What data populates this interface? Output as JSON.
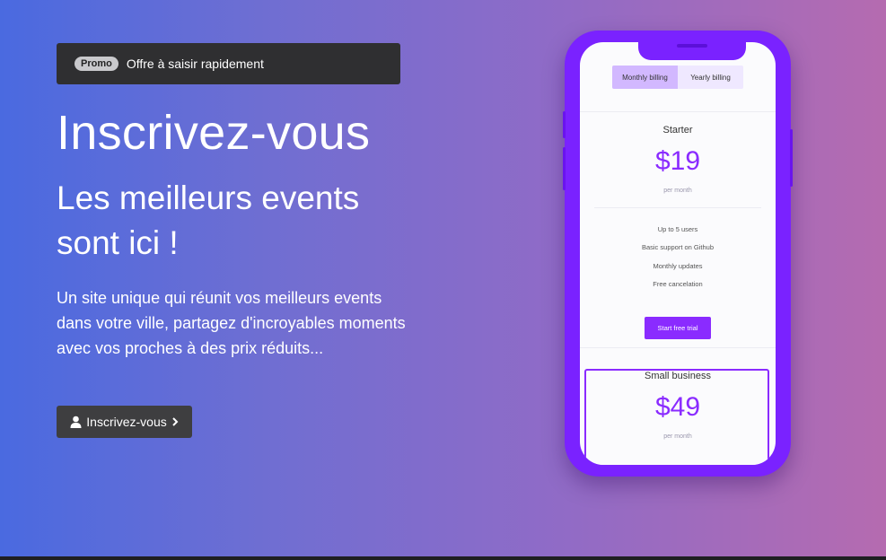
{
  "promo": {
    "badge": "Promo",
    "text": "Offre à saisir rapidement"
  },
  "hero": {
    "title": "Inscrivez-vous",
    "subtitle": "Les meilleurs events sont ici !",
    "description": "Un site unique qui réunit vos meilleurs events dans votre ville, partagez d'incroyables moments avec vos proches à des prix réduits...",
    "cta_label": "Inscrivez-vous",
    "cta_icons": [
      "user-icon",
      "chevron-right-icon"
    ]
  },
  "phone": {
    "billing": {
      "monthly_label": "Monthly billing",
      "yearly_label": "Yearly billing",
      "selected": "monthly"
    },
    "plans": [
      {
        "name": "Starter",
        "price": "$19",
        "period": "per month",
        "features": [
          "Up to 5 users",
          "Basic support on Github",
          "Monthly updates",
          "Free cancelation"
        ],
        "button": "Start free trial"
      },
      {
        "name": "Small business",
        "price": "$49",
        "period": "per month"
      }
    ]
  },
  "colors": {
    "gradient_start": "#4a6ae0",
    "gradient_end": "#b56bb0",
    "phone_accent": "#7a22ff",
    "price_color": "#8a2bff"
  }
}
